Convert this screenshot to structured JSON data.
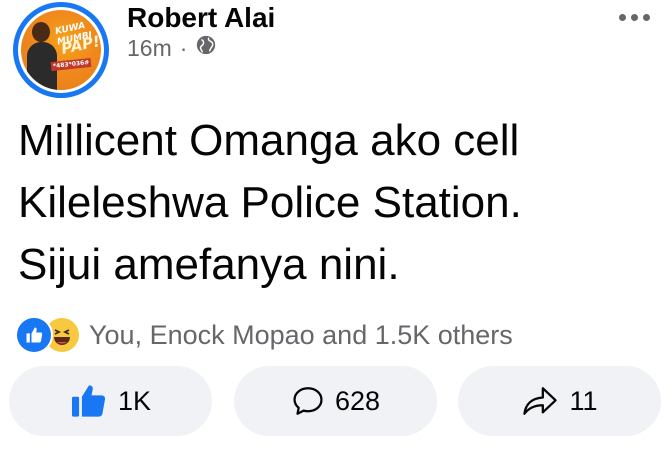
{
  "post": {
    "author": "Robert Alai",
    "time": "16m",
    "separator": "·",
    "privacy_icon": "globe-icon",
    "more_icon": "more-dots-icon",
    "avatar": {
      "line1": "KUWA",
      "line2": "MUMBI",
      "line3": "PAP!",
      "strip": "*483*036#",
      "background": "#f08a1c"
    },
    "text_lines": [
      "Millicent Omanga ako cell",
      "Kileleshwa Police Station.",
      "Sijui amefanya nini."
    ]
  },
  "reactions": {
    "icons": [
      "like-reaction-icon",
      "haha-reaction-icon"
    ],
    "summary": "You, Enock Mopao and 1.5K others"
  },
  "actions": {
    "like_count": "1K",
    "comment_count": "628",
    "share_count": "11"
  },
  "colors": {
    "accent": "#1877f2",
    "secondary_text": "#65676b",
    "button_bg": "#f0f2f5"
  }
}
